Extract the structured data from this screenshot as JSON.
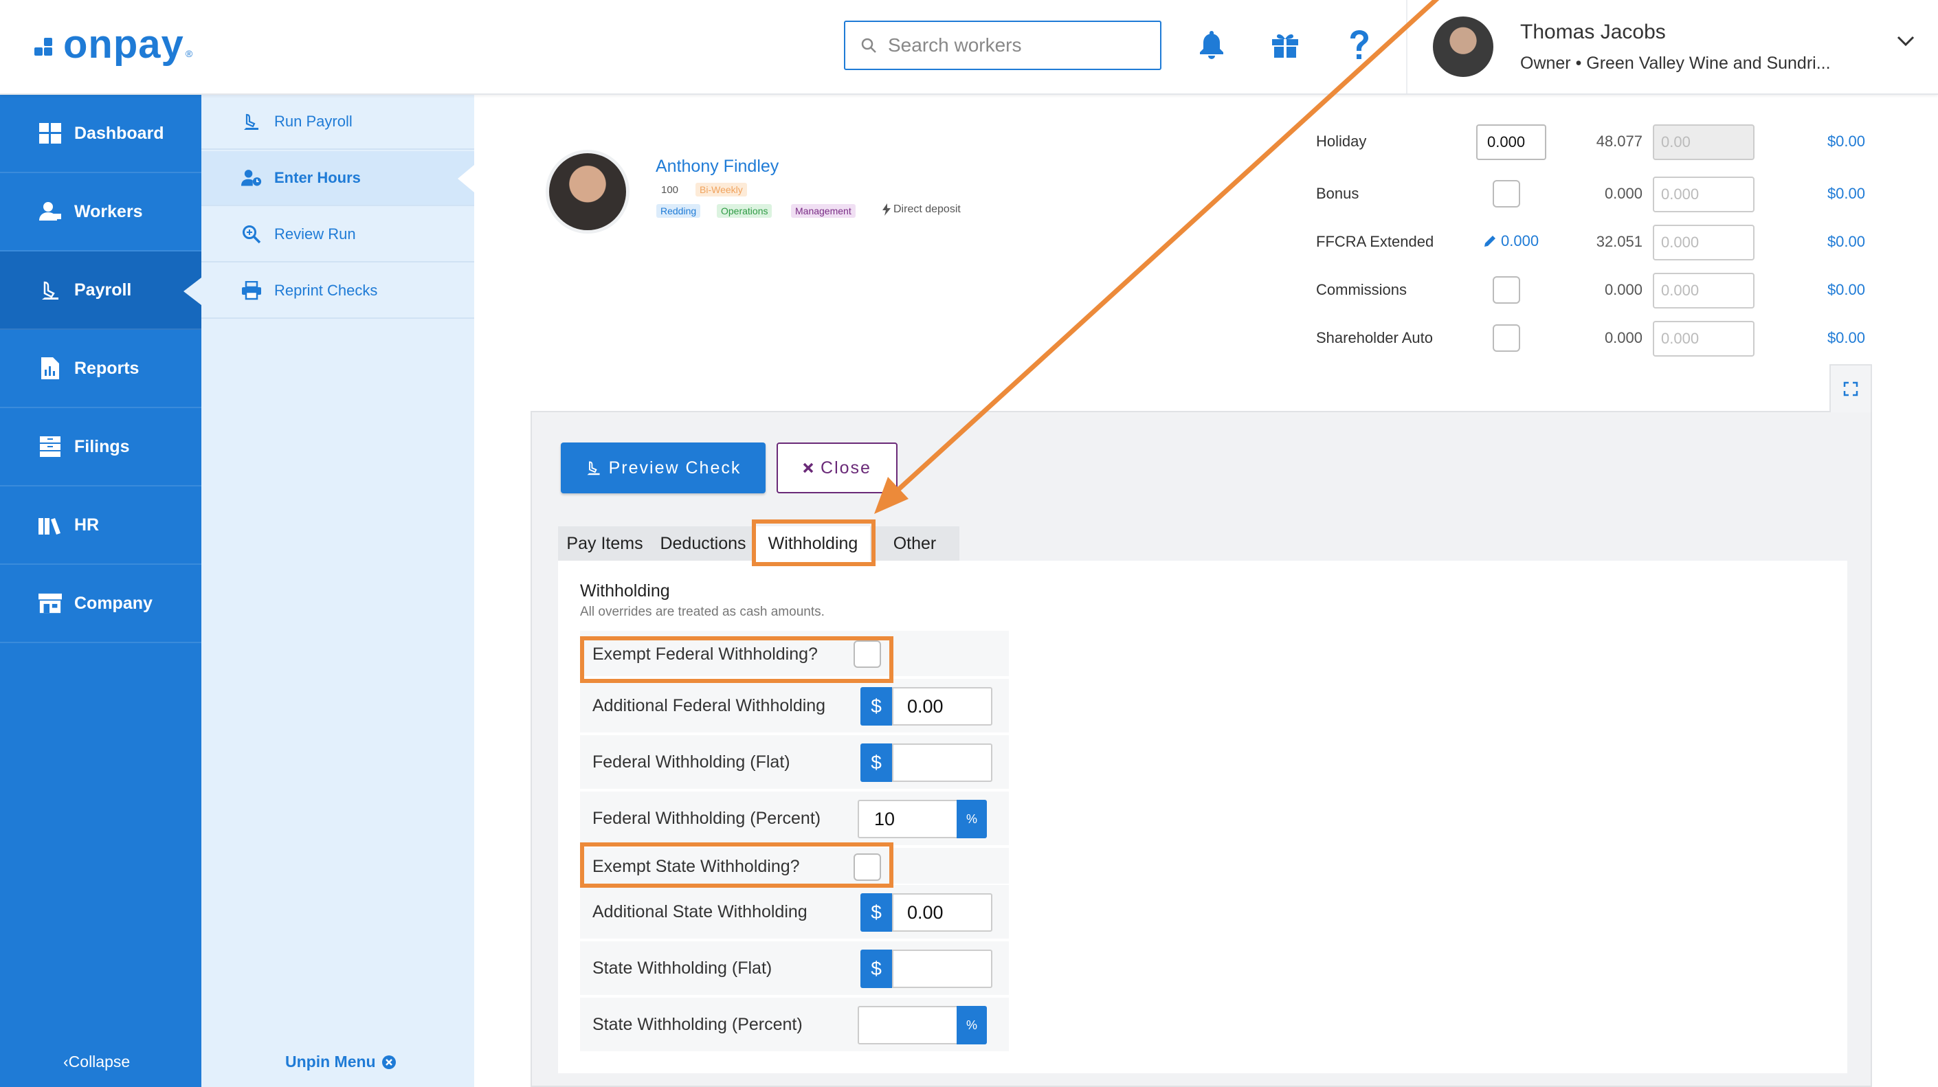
{
  "app": {
    "logo_text": "onpay",
    "logo_reg": "®"
  },
  "header": {
    "search_placeholder": "Search workers",
    "user_name": "Thomas Jacobs",
    "user_role": "Owner • Green Valley Wine and Sundri..."
  },
  "sidebar": {
    "items": [
      {
        "label": "Dashboard",
        "icon": "dashboard-icon"
      },
      {
        "label": "Workers",
        "icon": "workers-icon"
      },
      {
        "label": "Payroll",
        "icon": "payroll-icon",
        "active": true
      },
      {
        "label": "Reports",
        "icon": "reports-icon"
      },
      {
        "label": "Filings",
        "icon": "filings-icon"
      },
      {
        "label": "HR",
        "icon": "hr-icon"
      },
      {
        "label": "Company",
        "icon": "company-icon"
      }
    ],
    "collapse_label": "Collapse"
  },
  "subnav": {
    "items": [
      {
        "label": "Run Payroll",
        "icon": "run-payroll-icon"
      },
      {
        "label": "Enter Hours",
        "icon": "enter-hours-icon",
        "active": true
      },
      {
        "label": "Review Run",
        "icon": "review-run-icon"
      },
      {
        "label": "Reprint Checks",
        "icon": "printer-icon"
      }
    ],
    "unpin_label": "Unpin Menu"
  },
  "worker": {
    "name": "Anthony Findley",
    "id": "100",
    "schedule": "Bi-Weekly",
    "tags": [
      "Redding",
      "Operations",
      "Management"
    ],
    "deposit": "Direct deposit"
  },
  "earnings": {
    "rows": [
      {
        "label": "Holiday",
        "hours": "0.000",
        "rate": "48.077",
        "amount": "0.00",
        "total": "$0.00"
      },
      {
        "label": "Bonus",
        "hours": "",
        "rate": "0.000",
        "amount": "0.000",
        "total": "$0.00"
      },
      {
        "label": "FFCRA Extended",
        "hours": "0.000",
        "rate": "32.051",
        "amount": "0.000",
        "total": "$0.00"
      },
      {
        "label": "Commissions",
        "hours": "",
        "rate": "0.000",
        "amount": "0.000",
        "total": "$0.00"
      },
      {
        "label": "Shareholder Auto",
        "hours": "",
        "rate": "0.000",
        "amount": "0.000",
        "total": "$0.00"
      }
    ]
  },
  "panel": {
    "preview_label": "Preview Check",
    "close_label": "Close",
    "tabs": [
      "Pay Items",
      "Deductions",
      "Withholding",
      "Other"
    ],
    "active_tab": "Withholding"
  },
  "withholding": {
    "title": "Withholding",
    "subtitle": "All overrides are treated as cash amounts.",
    "currency_symbol": "$",
    "percent_symbol": "%",
    "rows": [
      {
        "label": "Exempt Federal Withholding?",
        "type": "checkbox"
      },
      {
        "label": "Additional Federal Withholding",
        "type": "money",
        "value": "0.00"
      },
      {
        "label": "Federal Withholding (Flat)",
        "type": "money",
        "value": ""
      },
      {
        "label": "Federal Withholding (Percent)",
        "type": "percent",
        "value": "10"
      },
      {
        "label": "Exempt State Withholding?",
        "type": "checkbox"
      },
      {
        "label": "Additional State Withholding",
        "type": "money",
        "value": "0.00"
      },
      {
        "label": "State Withholding (Flat)",
        "type": "money",
        "value": ""
      },
      {
        "label": "State Withholding (Percent)",
        "type": "percent",
        "value": ""
      }
    ]
  },
  "colors": {
    "brand": "#1f7bd6",
    "highlight": "#ec8a3a",
    "close_accent": "#6a2a78"
  }
}
